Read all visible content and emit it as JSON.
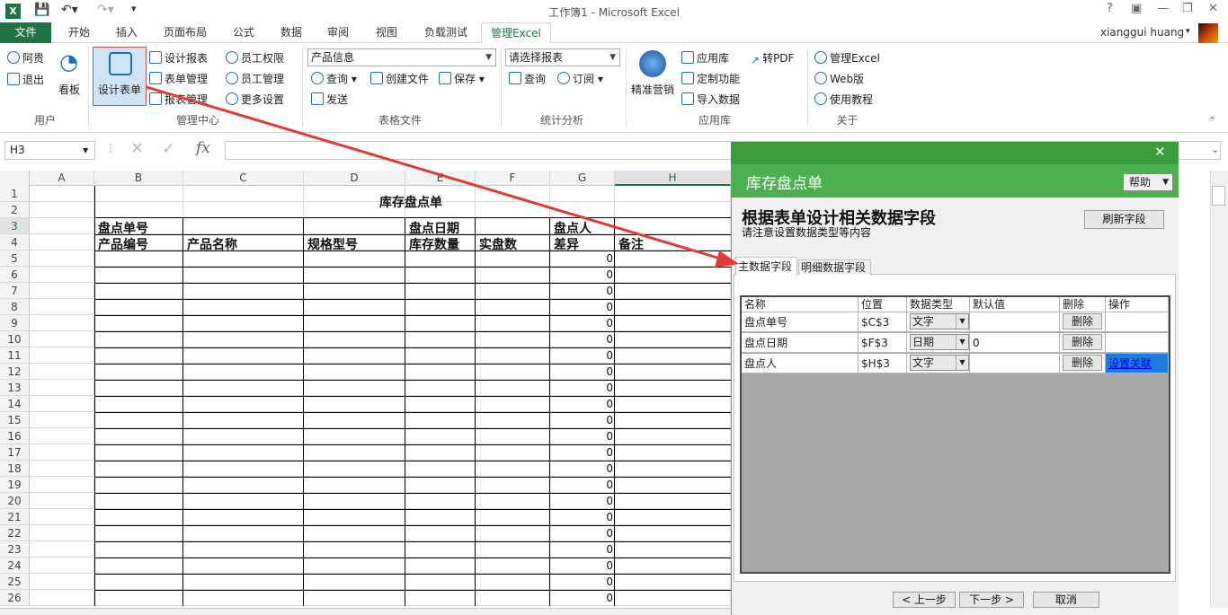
{
  "window": {
    "title": "工作簿1 - Microsoft Excel",
    "app_icon": "X",
    "help": "?",
    "user": "xianggui huang"
  },
  "tabs": [
    "文件",
    "开始",
    "插入",
    "页面布局",
    "公式",
    "数据",
    "审阅",
    "视图",
    "负载测试",
    "管理Excel"
  ],
  "ribbon": {
    "user_group": {
      "label": "用户",
      "a": "阿贵",
      "logout": "退出",
      "board": "看板"
    },
    "mgmt_group": {
      "label": "管理中心",
      "design_form": "设计表单",
      "design_report": "设计报表",
      "form_mgmt": "表单管理",
      "report_mgmt": "报表管理",
      "emp_perm": "员工权限",
      "emp_mgmt": "员工管理",
      "more": "更多设置"
    },
    "file_group": {
      "label": "表格文件",
      "combo": "产品信息",
      "query": "查询",
      "create": "创建文件",
      "save": "保存",
      "send": "发送"
    },
    "stats_group": {
      "label": "统计分析",
      "combo": "请选择报表",
      "query": "查询",
      "subscribe": "订阅"
    },
    "app_group": {
      "label": "应用库",
      "marketing": "精准营销",
      "applib": "应用库",
      "custom": "定制功能",
      "import": "导入数据",
      "pdf": "转PDF"
    },
    "about_group": {
      "label": "关于",
      "manage": "管理Excel",
      "web": "Web版",
      "tutorial": "使用教程"
    }
  },
  "formula": {
    "namebox": "H3",
    "fx": "fx"
  },
  "sheet": {
    "columns": [
      "A",
      "B",
      "C",
      "D",
      "E",
      "F",
      "G",
      "H"
    ],
    "rows": [
      "1",
      "2",
      "3",
      "4",
      "5",
      "6",
      "7",
      "8",
      "9",
      "10",
      "11",
      "12",
      "13",
      "14",
      "15",
      "16",
      "17",
      "18",
      "19",
      "20",
      "21",
      "22",
      "23",
      "24",
      "25",
      "26"
    ],
    "title": "库存盘点单",
    "r3": {
      "b": "盘点单号",
      "e": "盘点日期",
      "g": "盘点人"
    },
    "r4": {
      "b": "产品编号",
      "c": "产品名称",
      "d": "规格型号",
      "e": "库存数量",
      "f": "实盘数",
      "g": "差异",
      "h": "备注"
    },
    "zero": "0"
  },
  "dialog": {
    "title": "库存盘点单",
    "help": "帮助",
    "heading": "根据表单设计相关数据字段",
    "subheading": "请注意设置数据类型等内容",
    "refresh": "刷新字段",
    "tab_main": "主数据字段",
    "tab_detail": "明细数据字段",
    "headers": [
      "名称",
      "位置",
      "数据类型",
      "默认值",
      "删除",
      "操作"
    ],
    "fields": [
      {
        "name": "盘点单号",
        "pos": "$C$3",
        "type": "文字",
        "default": "",
        "del": "删除",
        "op": ""
      },
      {
        "name": "盘点日期",
        "pos": "$F$3",
        "type": "日期",
        "default": "0",
        "del": "删除",
        "op": ""
      },
      {
        "name": "盘点人",
        "pos": "$H$3",
        "type": "文字",
        "default": "",
        "del": "删除",
        "op": "设置关联"
      }
    ],
    "prev": "< 上一步",
    "next": "下一步 >",
    "cancel": "取消"
  }
}
